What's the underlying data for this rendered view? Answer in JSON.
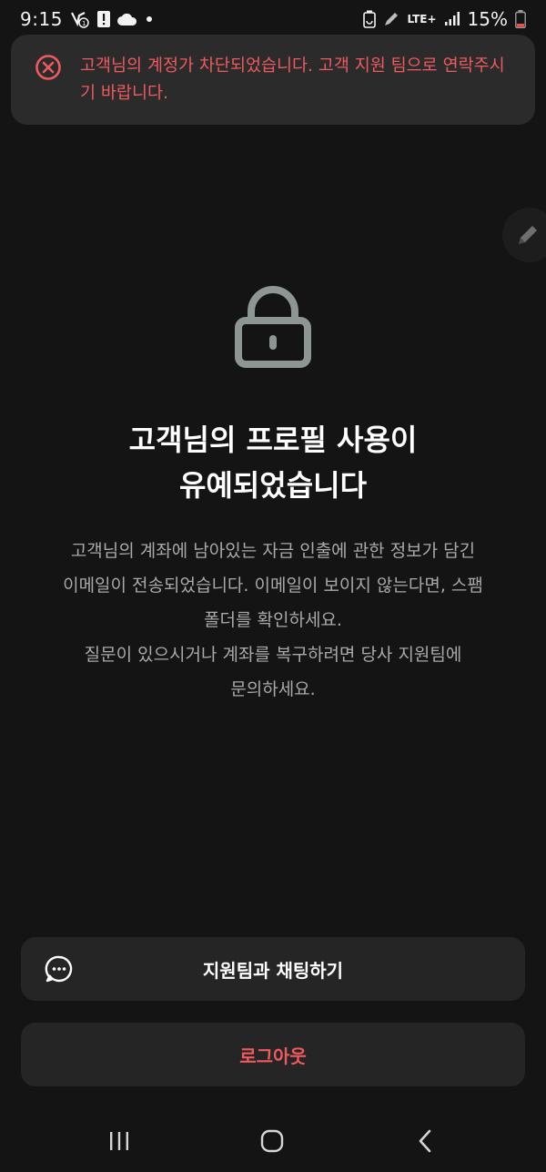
{
  "status_bar": {
    "time": "9:15",
    "network": "LTE+",
    "battery": "15%"
  },
  "toast": {
    "icon": "close-circle-icon",
    "message": "고객님의 계정가 차단되었습니다. 고객 지원 팀으로 연락주시기 바랍니다.",
    "color": "#ee5a5f"
  },
  "main": {
    "icon": "lock-icon",
    "title_lines": [
      "고객님의 프로필 사용이",
      "유예되었습니다"
    ],
    "body_lines": [
      "고객님의 계좌에 남아있는 자금 인출에 관한 정보가 담긴",
      "이메일이 전송되었습니다. 이메일이 보이지 않는다면, 스팸",
      "폴더를 확인하세요.",
      "질문이 있으시거나 계좌를 복구하려면 당사 지원팀에",
      "문의하세요."
    ]
  },
  "actions": {
    "chat_label": "지원팀과 채팅하기",
    "logout_label": "로그아웃"
  },
  "colors": {
    "background": "#141414",
    "accent_red": "#ee5a5f",
    "button_bg": "#252525"
  }
}
